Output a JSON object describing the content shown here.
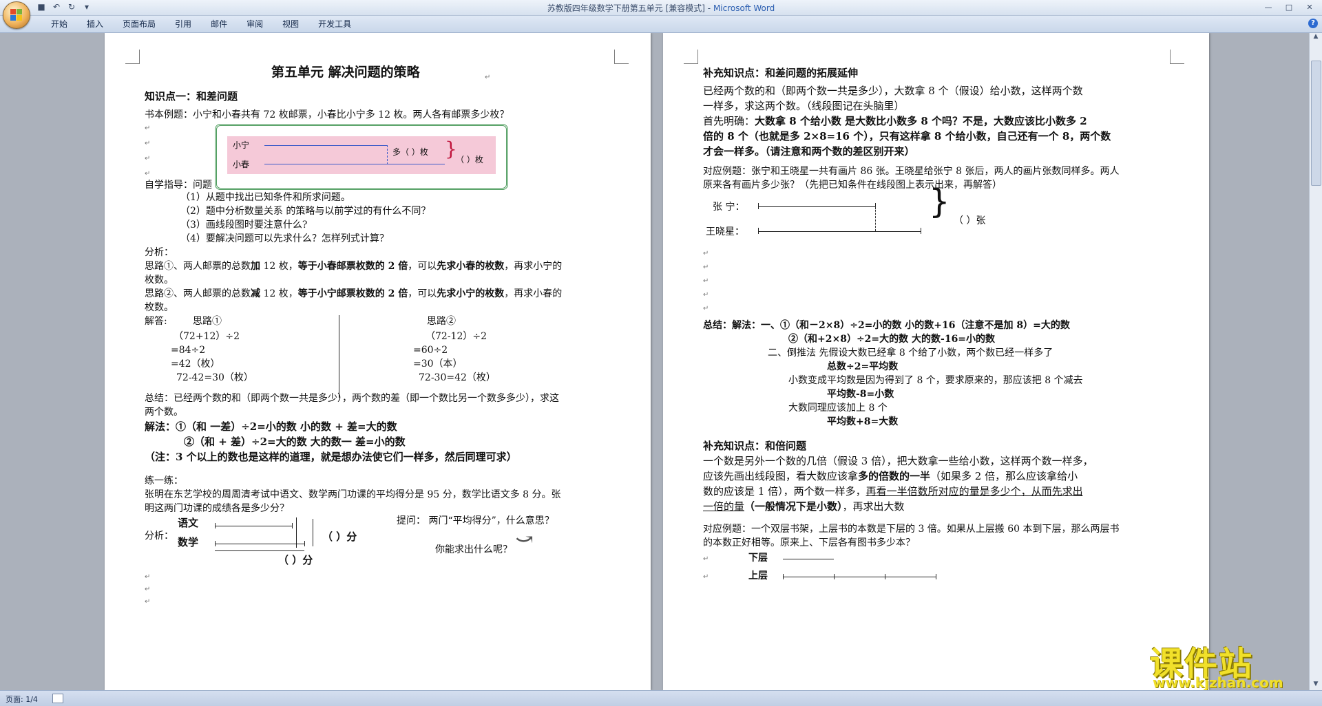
{
  "window": {
    "doc_title": "苏教版四年级数学下册第五单元 [兼容模式]",
    "separator": " - ",
    "app_name": "Microsoft Word"
  },
  "ribbon": {
    "tabs": [
      "开始",
      "插入",
      "页面布局",
      "引用",
      "邮件",
      "审阅",
      "视图",
      "开发工具"
    ]
  },
  "status": {
    "page_label": "页面: 1/4"
  },
  "watermark": {
    "main": "课件站",
    "url": "www.kjzhan.com"
  },
  "icons": {
    "office": "office-button-icon",
    "save": "save-icon",
    "undo": "undo-icon",
    "redo": "redo-icon",
    "help": "help-icon",
    "para_mark": "↵"
  },
  "page1": {
    "title": "第五单元    解决问题的策略",
    "kp1": "知识点一：和差问题",
    "example": "书本例题：小宁和小春共有 72 枚邮票，小春比小宁多 12 枚。两人各有邮票多少枚？",
    "diagram": {
      "xn": "小宁",
      "xc": "小春",
      "duo": "多（  ）枚",
      "total": "（    ）枚"
    },
    "guide": "自学指导：问题",
    "q1": "（1）从题中找出已知条件和所求问题。",
    "q2": "（2）题中分析数量关系  的策略与以前学过的有什么不同？",
    "q3": "（3）画线段图时要注意什么?",
    "q4": "（4）要解决问题可以先求什么？怎样列式计算？",
    "analysis": "分析：",
    "idea1_a": "思路①、两人邮票的总数",
    "idea1_b": "加",
    "idea1_c": " 12 枚，",
    "idea1_d": "等于小春邮票枚数的 2 倍",
    "idea1_e": "，可以",
    "idea1_f": "先求小春的枚数",
    "idea1_g": "，再求小宁的",
    "idea1_h": "枚数。",
    "idea2_a": "思路②、两人邮票的总数",
    "idea2_b": "减",
    "idea2_c": " 12 枚，",
    "idea2_d": "等于小宁邮票枚数的 2 倍",
    "idea2_e": "，可以",
    "idea2_f": "先求小宁的枚数",
    "idea2_g": "，再求小春的",
    "idea2_h": "枚数。",
    "ans_label": "解答:",
    "s1_h": "思路①",
    "s1_l1": "（72+12）÷2",
    "s1_l2": "=84÷2",
    "s1_l3": "=42（枚）",
    "s1_l4": "72-42=30（枚）",
    "s2_h": "思路②",
    "s2_l1": "（72-12）÷2",
    "s2_l2": "=60÷2",
    "s2_l3": "=30（本）",
    "s2_l4": "72-30=42（枚）",
    "sum1": "总结：已经两个数的和（即两个数一共是多少），两个数的差（即一个数比另一个数多多少），求这",
    "sum2": "两个数。",
    "m1": "解法：①（和 一差）÷2=小的数  小的数 + 差=大的数",
    "m2": "②（和 + 差）÷2=大的数  大的数一 差=小的数",
    "note": "（注：3 个以上的数也是这样的道理，就是想办法使它们一样多，然后同理可求）",
    "practice": "练一练：",
    "pr1": "张明在东艺学校的周周清考试中语文、数学两门功课的平均得分是 95 分，数学比语文多 8 分。张",
    "pr2": "明这两门功课的成绩各是多少分？",
    "ask": "提问：  两门“平均得分”，什么意思？",
    "ask2": "你能求出什么呢？",
    "an_label": "分析：",
    "yw": "语文",
    "sx": "数学",
    "fen1": "（    ）分",
    "fen2": "（   ）分"
  },
  "page2": {
    "h1": "补充知识点：和差问题的拓展延伸",
    "p1a": "已经两个数的和（即两个数一共是多少），大数拿 8 个（假设）给小数，这样两个数",
    "p1b": "一样多，求这两个数。（线段图记在头脑里）",
    "p2a_1": "首先明确：",
    "p2a_2": "大数拿 8 个给小数  是大数比小数多 8 个吗？不是，大数应该比小数多 2",
    "p2b": "倍的 8 个（也就是多 2×8=16 个），只有这样拿 8 个给小数，自己还有一个 8，两个数",
    "p2c": "才会一样多。（请注意和两个数的差区别开来）",
    "ex1a": "对应例题：张宁和王晓星一共有画片 86 张。王晓星给张宁 8 张后，两人的画片张数同样多。两人",
    "ex1b": "原来各有画片多少张？（先把已知条件在线段图上表示出来，再解答）",
    "zn": "张  宁：",
    "wxx": "王晓星：",
    "zhang": "（    ）张",
    "s_1a": "总结：解法：一、",
    "s_1b": "①（和－2×8）÷2=小的数  小的数+16（注意不是加 8）=大的数",
    "s_2": "②（和+2×8）÷2=大的数  大的数-16=小的数",
    "s_3": "二、倒推法  先假设大数已经拿 8 个给了小数，两个数已经一样多了",
    "s_4": "总数÷2=平均数",
    "s_5": "小数变成平均数是因为得到了 8 个，要求原来的，那应该把 8 个减去",
    "s_6": "平均数-8=小数",
    "s_7": "大数同理应该加上 8 个",
    "s_8": "平均数+8=大数",
    "h2": "补充知识点：和倍问题",
    "q1a": "一个数是另外一个数的几倍（假设 3 倍），把大数拿一些给小数，这样两个数一样多，",
    "q1b_1": "应该先画出线段图，看大数应该拿",
    "q1b_2": "多的倍数的一半",
    "q1b_3": "（如果多 2 倍，那么应该拿给小",
    "q1c_1": "数的应该是 1 倍），两个数一样多，",
    "q1c_2": "再看一半倍数所对应的量是多少个，从而先求出",
    "q1d_1": "一倍的量",
    "q1d_2": "（一般情况下是小数）",
    "q1d_3": "，再求出大数",
    "ex2a": "对应例题：一个双层书架，上层书的本数是下层的 3 倍。如果从上层搬 60 本到下层，那么两层书",
    "ex2b": "的本数正好相等。原来上、下层各有图书多少本？",
    "xc": "下层",
    "sc": "上层"
  }
}
